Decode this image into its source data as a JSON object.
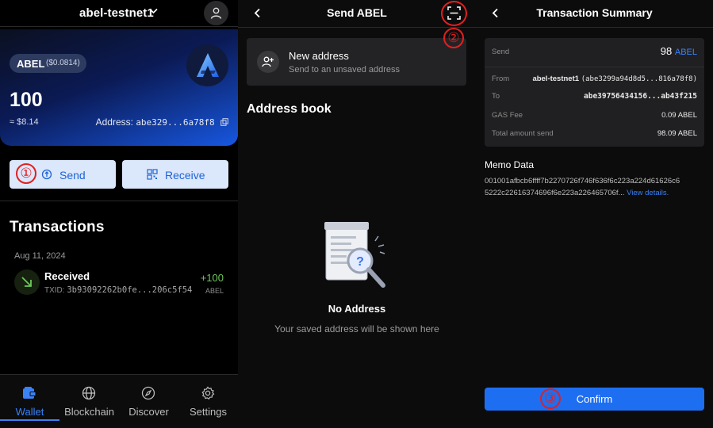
{
  "panel1": {
    "network": "abel-testnet1",
    "token": {
      "symbol": "ABEL",
      "price": "($0.0814)"
    },
    "balance": "100",
    "fiat": "≈ $8.14",
    "address_label": "Address:",
    "address_value": "abe329...6a78f8",
    "buttons": {
      "send": "Send",
      "receive": "Receive"
    },
    "transactions_title": "Transactions",
    "tx": {
      "date": "Aug 11, 2024",
      "type": "Received",
      "amount": "+100",
      "unit": "ABEL",
      "txid_label": "TXID:",
      "txid": "3b93092262b0fe...206c5f54"
    },
    "nav": [
      "Wallet",
      "Blockchain",
      "Discover",
      "Settings"
    ]
  },
  "panel2": {
    "title": "Send ABEL",
    "new_address_title": "New address",
    "new_address_sub": "Send to an unsaved address",
    "address_book_title": "Address book",
    "empty_title": "No Address",
    "empty_sub": "Your saved address will be shown here"
  },
  "panel3": {
    "title": "Transaction Summary",
    "send_label": "Send",
    "send_amount": "98",
    "send_unit": "ABEL",
    "from_label": "From",
    "from_name": "abel-testnet1",
    "from_addr": "(abe3299a94d8d5...816a78f8)",
    "to_label": "To",
    "to_addr": "abe39756434156...ab43f215",
    "gas_label": "GAS Fee",
    "gas_value": "0.09 ABEL",
    "total_label": "Total amount send",
    "total_value": "98.09 ABEL",
    "memo_title": "Memo Data",
    "memo_text": "001001afbcb6ffff7b2270726f746f636f6c223a224d61626c65222c22616374696f6e223a226465706f...",
    "memo_link": "View details.",
    "confirm": "Confirm"
  },
  "steps": {
    "one": "①",
    "two": "②",
    "three": "③"
  },
  "colors": {
    "accent": "#1e6ef2",
    "received": "#6dc65b",
    "marker": "#e02020"
  }
}
